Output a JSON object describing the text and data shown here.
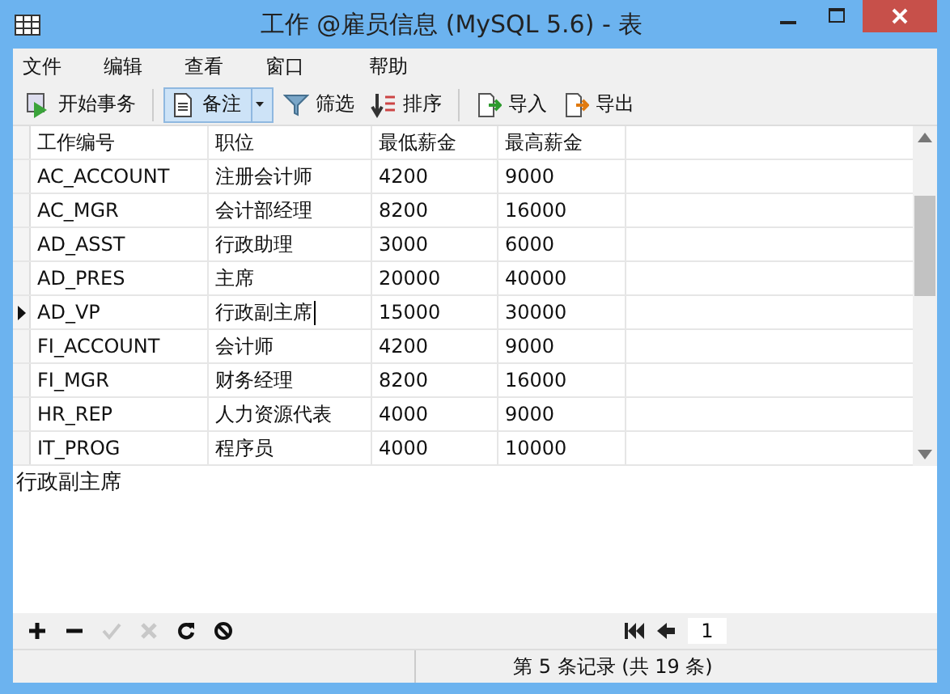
{
  "window": {
    "title": "工作 @雇员信息 (MySQL 5.6) - 表"
  },
  "menu": [
    "文件",
    "编辑",
    "查看",
    "窗口",
    "帮助"
  ],
  "toolbar": [
    {
      "kind": "transaction",
      "label": "开始事务",
      "selected": false
    },
    {
      "kind": "memo",
      "label": "备注",
      "selected": true
    },
    {
      "kind": "filter",
      "label": "筛选",
      "selected": false
    },
    {
      "kind": "sort",
      "label": "排序",
      "selected": false
    },
    {
      "kind": "import",
      "label": "导入",
      "selected": false
    },
    {
      "kind": "export",
      "label": "导出",
      "selected": false
    }
  ],
  "table": {
    "columns": [
      "工作编号",
      "职位",
      "最低薪金",
      "最高薪金"
    ],
    "rows": [
      {
        "cells": [
          "AC_ACCOUNT",
          "注册会计师",
          "4200",
          "9000"
        ],
        "selected": false
      },
      {
        "cells": [
          "AC_MGR",
          "会计部经理",
          "8200",
          "16000"
        ],
        "selected": false
      },
      {
        "cells": [
          "AD_ASST",
          "行政助理",
          "3000",
          "6000"
        ],
        "selected": false
      },
      {
        "cells": [
          "AD_PRES",
          "主席",
          "20000",
          "40000"
        ],
        "selected": false
      },
      {
        "cells": [
          "AD_VP",
          "行政副主席",
          "15000",
          "30000"
        ],
        "selected": true
      },
      {
        "cells": [
          "FI_ACCOUNT",
          "会计师",
          "4200",
          "9000"
        ],
        "selected": false
      },
      {
        "cells": [
          "FI_MGR",
          "财务经理",
          "8200",
          "16000"
        ],
        "selected": false
      },
      {
        "cells": [
          "HR_REP",
          "人力资源代表",
          "4000",
          "9000"
        ],
        "selected": false
      },
      {
        "cells": [
          "IT_PROG",
          "程序员",
          "4000",
          "10000"
        ],
        "selected": false
      }
    ]
  },
  "memo": {
    "value": "行政副主席"
  },
  "bottom_tools": [
    {
      "kind": "add",
      "disabled": false
    },
    {
      "kind": "delete",
      "disabled": false
    },
    {
      "kind": "apply",
      "disabled": true
    },
    {
      "kind": "discard",
      "disabled": true
    },
    {
      "kind": "refresh",
      "disabled": false
    },
    {
      "kind": "stop",
      "disabled": false
    }
  ],
  "pager": {
    "page": "1"
  },
  "status_bar": "第 5 条记录 (共 19 条)"
}
